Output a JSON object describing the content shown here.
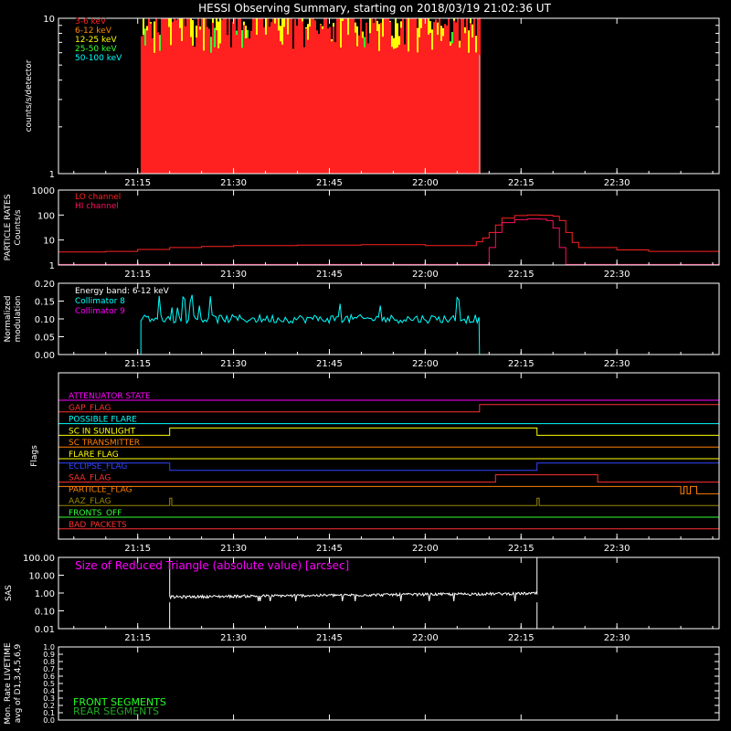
{
  "title": "HESSI Observing Summary, starting on 2018/03/19 21:02:36 UT",
  "time_axis": {
    "start": "21:02:36",
    "end": "22:46:00",
    "tick_labels": [
      "21:15",
      "21:30",
      "21:45",
      "22:00",
      "22:15",
      "22:30"
    ],
    "tick_times": [
      "21:15",
      "21:30",
      "21:45",
      "22:00",
      "22:15",
      "22:30"
    ]
  },
  "chart_data": [
    {
      "type": "bar",
      "name": "count-rates",
      "ylabel": "counts/s/detector",
      "scale": "log",
      "ylim": [
        1,
        10
      ],
      "ytick_labels": [
        "1",
        "10"
      ],
      "data_start": "21:15:30",
      "data_end": "22:08:30",
      "series": [
        {
          "name": "3-6 keV",
          "color": "#ff2020",
          "level": 9.2,
          "spread": 0.7
        },
        {
          "name": "6-12 keV",
          "color": "#ff8800",
          "level": 2.9,
          "spread": 0.8
        },
        {
          "name": "12-25 keV",
          "color": "#ffff00",
          "level": 8.2,
          "spread": 1.0
        },
        {
          "name": "25-50 keV",
          "color": "#33ff33",
          "level": 6.4,
          "spread": 0.8
        },
        {
          "name": "50-100 keV",
          "color": "#00ffff",
          "level": 5.0,
          "spread": 0.8
        }
      ]
    },
    {
      "type": "line",
      "name": "particle-rates",
      "ylabel": "PARTICLE RATES\nCounts/s",
      "scale": "log",
      "ylim": [
        1,
        1000
      ],
      "ytick_labels": [
        "1",
        "10",
        "100",
        "1000"
      ],
      "series": [
        {
          "name": "LO channel",
          "color": "#ff2020",
          "points": [
            [
              "21:02:36",
              3.3
            ],
            [
              "21:05",
              3.3
            ],
            [
              "21:10",
              3.5
            ],
            [
              "21:15",
              4.2
            ],
            [
              "21:20",
              5.0
            ],
            [
              "21:25",
              5.5
            ],
            [
              "21:30",
              6.0
            ],
            [
              "21:40",
              6.2
            ],
            [
              "21:50",
              6.5
            ],
            [
              "22:00",
              6.0
            ],
            [
              "22:05",
              6.0
            ],
            [
              "22:08",
              8.5
            ],
            [
              "22:09",
              12
            ],
            [
              "22:10",
              20
            ],
            [
              "22:11",
              40
            ],
            [
              "22:12",
              75
            ],
            [
              "22:14",
              95
            ],
            [
              "22:16",
              100
            ],
            [
              "22:18",
              98
            ],
            [
              "22:20",
              90
            ],
            [
              "22:21",
              60
            ],
            [
              "22:22",
              20
            ],
            [
              "22:23",
              8
            ],
            [
              "22:24",
              5
            ],
            [
              "22:30",
              4
            ],
            [
              "22:35",
              3.5
            ],
            [
              "22:40",
              3.5
            ],
            [
              "22:46",
              3.2
            ]
          ]
        },
        {
          "name": "HI channel",
          "color": "#ff1060",
          "points": [
            [
              "21:02:36",
              1.05
            ],
            [
              "22:09",
              1.05
            ],
            [
              "22:10",
              5
            ],
            [
              "22:11",
              20
            ],
            [
              "22:12",
              50
            ],
            [
              "22:14",
              65
            ],
            [
              "22:16",
              70
            ],
            [
              "22:18",
              68
            ],
            [
              "22:19",
              60
            ],
            [
              "22:20",
              30
            ],
            [
              "22:21",
              5
            ],
            [
              "22:22",
              1.05
            ],
            [
              "22:46",
              1.05
            ]
          ]
        }
      ]
    },
    {
      "type": "line",
      "name": "modulation",
      "ylabel": "Normalized\nmodulation",
      "ylim": [
        0,
        0.2
      ],
      "ytick_labels": [
        "0.00",
        "0.05",
        "0.10",
        "0.15",
        "0.20"
      ],
      "annotation": "Energy band: 6-12 keV",
      "data_start": "21:15:30",
      "data_end": "22:08:30",
      "series": [
        {
          "name": "Collimator 8",
          "color": "#00ffff",
          "mean": 0.1,
          "noise": 0.012
        },
        {
          "name": "Collimator 9",
          "color": "#ff00ff"
        }
      ]
    },
    {
      "type": "step",
      "name": "flags",
      "ylabel": "Flags",
      "flags": [
        {
          "label": "ATTENUATOR STATE",
          "color": "#ff00ff",
          "high": []
        },
        {
          "label": "GAP_FLAG",
          "color": "#ff3030",
          "high": [
            [
              "22:08:30",
              "22:46:00"
            ]
          ]
        },
        {
          "label": "POSSIBLE FLARE",
          "color": "#00ffff",
          "high": []
        },
        {
          "label": "SC IN SUNLIGHT",
          "color": "#ffff00",
          "high": [
            [
              "21:20:00",
              "22:17:30"
            ]
          ]
        },
        {
          "label": "SC TRANSMITTER",
          "color": "#ff8000",
          "high": []
        },
        {
          "label": "FLARE FLAG",
          "color": "#ffff00",
          "high": []
        },
        {
          "label": "ECLIPSE_FLAG",
          "color": "#3344ff",
          "high": [
            [
              "21:02:36",
              "21:20:00"
            ],
            [
              "22:17:30",
              "22:46:00"
            ]
          ]
        },
        {
          "label": "SAA_FLAG",
          "color": "#ff3030",
          "high": [
            [
              "22:11:00",
              "22:27:00"
            ]
          ]
        },
        {
          "label": "PARTICLE_FLAG",
          "color": "#ff8000",
          "high": [
            [
              "21:02:36",
              "22:40:00"
            ],
            [
              "22:40:30",
              "22:41:00"
            ],
            [
              "22:41:30",
              "22:42:30"
            ]
          ]
        },
        {
          "label": "AAZ_FLAG",
          "color": "#998800",
          "high": [
            [
              "21:20:00",
              "21:20:20"
            ],
            [
              "22:17:30",
              "22:17:50"
            ]
          ]
        },
        {
          "label": "FRONTS_OFF",
          "color": "#33ff33",
          "high": []
        },
        {
          "label": "BAD_PACKETS",
          "color": "#ff3030",
          "high": []
        }
      ]
    },
    {
      "type": "line",
      "name": "sas",
      "ylabel": "SAS",
      "scale": "log",
      "ylim": [
        0.01,
        100
      ],
      "ytick_labels": [
        "100.00",
        "10.00",
        "1.00",
        "0.10",
        "0.01"
      ],
      "annotation": "Size of Reduced Triangle (absolute value) [arcsec]",
      "annotation_color": "#ff00ff",
      "data_start": "21:20:00",
      "data_end": "22:17:30",
      "base_level_start": 0.6,
      "base_level_end": 0.95
    },
    {
      "type": "line",
      "name": "livetime",
      "ylabel": "Mon. Rate LIVETIME\navg of D1,3,4,5,6,9",
      "ylim": [
        0,
        1.0
      ],
      "ytick_labels": [
        "0.0",
        "0.1",
        "0.2",
        "0.3",
        "0.4",
        "0.5",
        "0.6",
        "0.7",
        "0.8",
        "0.9",
        "1.0"
      ],
      "series": [
        {
          "name": "FRONT SEGMENTS",
          "color": "#22ff22"
        },
        {
          "name": "REAR SEGMENTS",
          "color": "#22aa22"
        }
      ]
    }
  ]
}
